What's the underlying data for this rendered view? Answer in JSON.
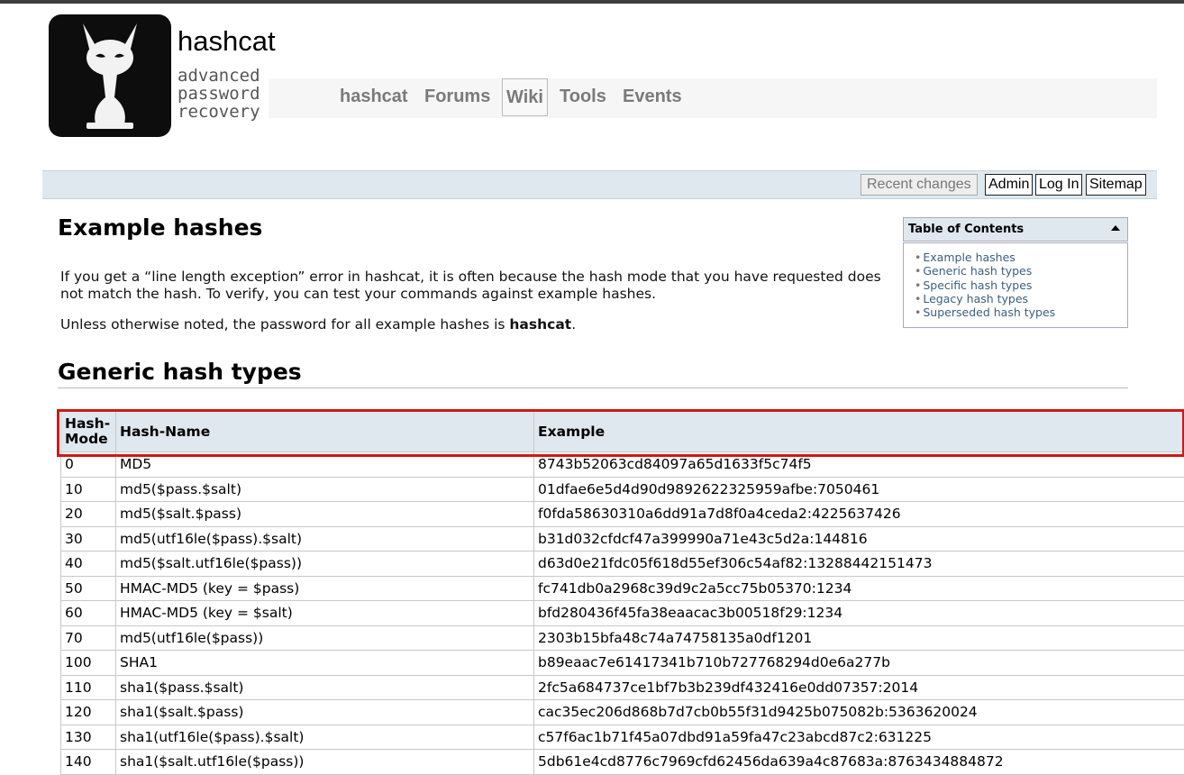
{
  "brand": {
    "title": "hashcat",
    "subtitle_lines": [
      "advanced",
      "password",
      "recovery"
    ]
  },
  "nav": {
    "items": [
      {
        "label": "hashcat",
        "active": false
      },
      {
        "label": "Forums",
        "active": false
      },
      {
        "label": "Wiki",
        "active": true
      },
      {
        "label": "Tools",
        "active": false
      },
      {
        "label": "Events",
        "active": false
      }
    ]
  },
  "actions": {
    "recent_changes": "Recent changes",
    "admin": "Admin",
    "login": "Log In",
    "sitemap": "Sitemap"
  },
  "page": {
    "title": "Example hashes",
    "intro": "If you get a “line length exception” error in hashcat, it is often because the hash mode that you have requested does not match the hash. To verify, you can test your commands against example hashes.",
    "note_prefix": "Unless otherwise noted, the password for all example hashes is ",
    "note_password": "hashcat",
    "note_suffix": ".",
    "section_title": "Generic hash types"
  },
  "toc": {
    "title": "Table of Contents",
    "items": [
      "Example hashes",
      "Generic hash types",
      "Specific hash types",
      "Legacy hash types",
      "Superseded hash types"
    ]
  },
  "table": {
    "headers": [
      "Hash-Mode",
      "Hash-Name",
      "Example"
    ],
    "rows": [
      [
        "0",
        "MD5",
        "8743b52063cd84097a65d1633f5c74f5"
      ],
      [
        "10",
        "md5($pass.$salt)",
        "01dfae6e5d4d90d9892622325959afbe:7050461"
      ],
      [
        "20",
        "md5($salt.$pass)",
        "f0fda58630310a6dd91a7d8f0a4ceda2:4225637426"
      ],
      [
        "30",
        "md5(utf16le($pass).$salt)",
        "b31d032cfdcf47a399990a71e43c5d2a:144816"
      ],
      [
        "40",
        "md5($salt.utf16le($pass))",
        "d63d0e21fdc05f618d55ef306c54af82:13288442151473"
      ],
      [
        "50",
        "HMAC-MD5 (key = $pass)",
        "fc741db0a2968c39d9c2a5cc75b05370:1234"
      ],
      [
        "60",
        "HMAC-MD5 (key = $salt)",
        "bfd280436f45fa38eaacac3b00518f29:1234"
      ],
      [
        "70",
        "md5(utf16le($pass))",
        "2303b15bfa48c74a74758135a0df1201"
      ],
      [
        "100",
        "SHA1",
        "b89eaac7e61417341b710b727768294d0e6a277b"
      ],
      [
        "110",
        "sha1($pass.$salt)",
        "2fc5a684737ce1bf7b3b239df432416e0dd07357:2014"
      ],
      [
        "120",
        "sha1($salt.$pass)",
        "cac35ec206d868b7d7cb0b55f31d9425b075082b:5363620024"
      ],
      [
        "130",
        "sha1(utf16le($pass).$salt)",
        "c57f6ac1b71f45a07dbd91a59fa47c23abcd87c2:631225"
      ],
      [
        "140",
        "sha1($salt.utf16le($pass))",
        "5db61e4cd8776c7969cfd62456da639a4c87683a:8763434884872"
      ]
    ]
  }
}
